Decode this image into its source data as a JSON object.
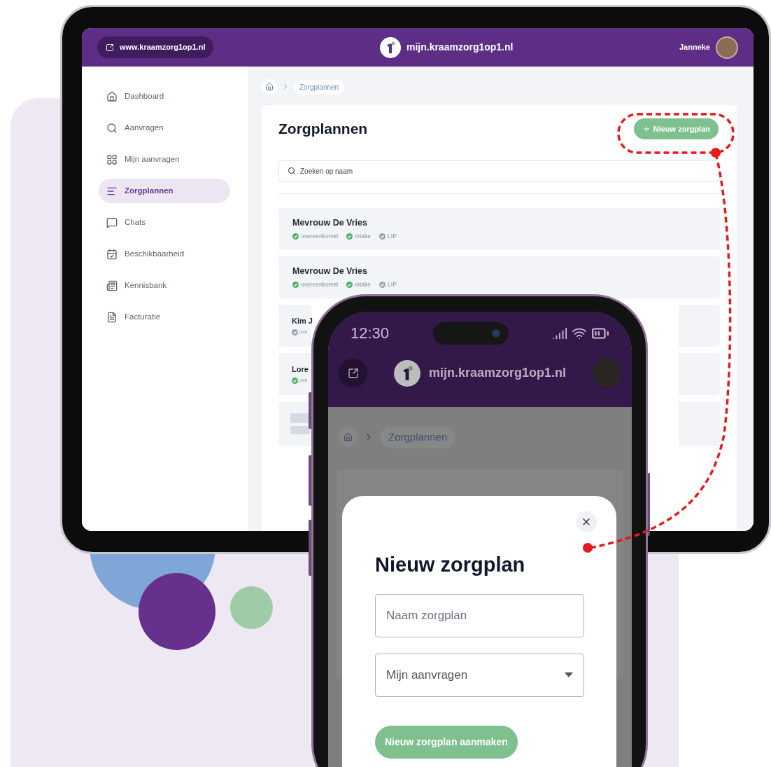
{
  "tablet": {
    "url_pill": "www.kraamzorg1op1.nl",
    "site_title": "mijn.kraamzorg1op1.nl",
    "user_name": "Janneke",
    "sidebar": {
      "items": [
        {
          "label": "Dashboard",
          "selected": false
        },
        {
          "label": "Aanvragen",
          "selected": false
        },
        {
          "label": "Mijn aanvragen",
          "selected": false
        },
        {
          "label": "Zorgplannen",
          "selected": true
        },
        {
          "label": "Chats",
          "selected": false
        },
        {
          "label": "Beschikbaarheid",
          "selected": false
        },
        {
          "label": "Kennisbank",
          "selected": false
        },
        {
          "label": "Facturatie",
          "selected": false
        }
      ]
    },
    "breadcrumb": "Zorgplannen",
    "page_title": "Zorgplannen",
    "new_button": "Nieuw zorgplan",
    "search": {
      "placeholder": "Zoeken op naam"
    },
    "rows": [
      {
        "kind": "entry",
        "name": "Mevrouw De Vries",
        "tags": [
          {
            "label": "overeenkomst",
            "done": true
          },
          {
            "label": "intake",
            "done": true
          },
          {
            "label": "LIP",
            "done": false
          }
        ]
      },
      {
        "kind": "entry",
        "name": "Mevrouw De Vries",
        "tags": [
          {
            "label": "overeenkomst",
            "done": true
          },
          {
            "label": "intake",
            "done": true
          },
          {
            "label": "LIP",
            "done": false
          }
        ]
      },
      {
        "kind": "partial",
        "name": "Kim J",
        "tags": [
          {
            "label": "ove",
            "done": false
          }
        ]
      },
      {
        "kind": "partial",
        "name": "Lore",
        "tags": [
          {
            "label": "ove",
            "done": true
          }
        ]
      },
      {
        "kind": "skeleton"
      }
    ]
  },
  "phone": {
    "time": "12:30",
    "site_title": "mijn.kraamzorg1op1.nl",
    "breadcrumb": "Zorgplannen",
    "modal": {
      "title": "Nieuw zorgplan",
      "name_field": {
        "placeholder": "Naam zorgplan"
      },
      "select": {
        "value": "Mijn aanvragen"
      },
      "submit": "Nieuw zorgplan aanmaken"
    }
  }
}
